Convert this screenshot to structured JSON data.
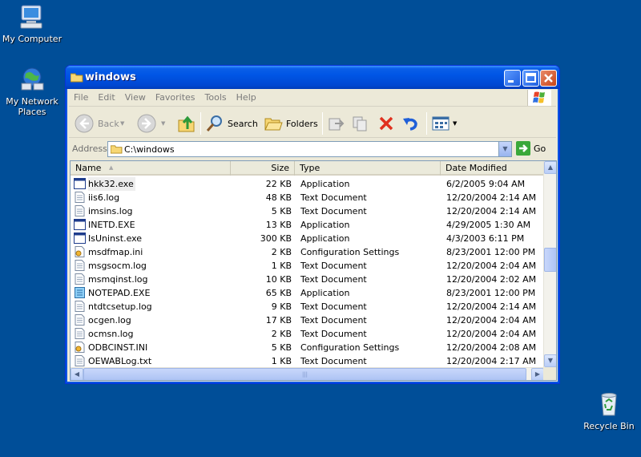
{
  "desktop": {
    "icons": [
      {
        "label": "My Computer",
        "icon": "my-computer-icon"
      },
      {
        "label": "My Network Places",
        "icon": "network-places-icon"
      },
      {
        "label": "Recycle Bin",
        "icon": "recycle-bin-icon"
      }
    ],
    "background_color": "#004e98"
  },
  "window": {
    "title": "windows",
    "menu": [
      "File",
      "Edit",
      "View",
      "Favorites",
      "Tools",
      "Help"
    ],
    "toolbar": {
      "back_label": "Back",
      "search_label": "Search",
      "folders_label": "Folders"
    },
    "address": {
      "label": "Address",
      "value": "C:\\windows",
      "go_label": "Go"
    },
    "columns": {
      "name": "Name",
      "size": "Size",
      "type": "Type",
      "modified": "Date Modified"
    },
    "files": [
      {
        "name": "hkk32.exe",
        "size": "22 KB",
        "type": "Application",
        "modified": "6/2/2005 9:04 AM",
        "icon": "application-icon"
      },
      {
        "name": "iis6.log",
        "size": "48 KB",
        "type": "Text Document",
        "modified": "12/20/2004 2:14 AM",
        "icon": "text-document-icon"
      },
      {
        "name": "imsins.log",
        "size": "5 KB",
        "type": "Text Document",
        "modified": "12/20/2004 2:14 AM",
        "icon": "text-document-icon"
      },
      {
        "name": "INETD.EXE",
        "size": "13 KB",
        "type": "Application",
        "modified": "4/29/2005 1:30 AM",
        "icon": "application-icon"
      },
      {
        "name": "IsUninst.exe",
        "size": "300 KB",
        "type": "Application",
        "modified": "4/3/2003 6:11 PM",
        "icon": "application-icon"
      },
      {
        "name": "msdfmap.ini",
        "size": "2 KB",
        "type": "Configuration Settings",
        "modified": "8/23/2001 12:00 PM",
        "icon": "config-settings-icon"
      },
      {
        "name": "msgsocm.log",
        "size": "1 KB",
        "type": "Text Document",
        "modified": "12/20/2004 2:04 AM",
        "icon": "text-document-icon"
      },
      {
        "name": "msmqinst.log",
        "size": "10 KB",
        "type": "Text Document",
        "modified": "12/20/2004 2:02 AM",
        "icon": "text-document-icon"
      },
      {
        "name": "NOTEPAD.EXE",
        "size": "65 KB",
        "type": "Application",
        "modified": "8/23/2001 12:00 PM",
        "icon": "notepad-icon"
      },
      {
        "name": "ntdtcsetup.log",
        "size": "9 KB",
        "type": "Text Document",
        "modified": "12/20/2004 2:14 AM",
        "icon": "text-document-icon"
      },
      {
        "name": "ocgen.log",
        "size": "17 KB",
        "type": "Text Document",
        "modified": "12/20/2004 2:04 AM",
        "icon": "text-document-icon"
      },
      {
        "name": "ocmsn.log",
        "size": "2 KB",
        "type": "Text Document",
        "modified": "12/20/2004 2:04 AM",
        "icon": "text-document-icon"
      },
      {
        "name": "ODBCINST.INI",
        "size": "5 KB",
        "type": "Configuration Settings",
        "modified": "12/20/2004 2:08 AM",
        "icon": "config-settings-icon"
      },
      {
        "name": "OEWABLog.txt",
        "size": "1 KB",
        "type": "Text Document",
        "modified": "12/20/2004 2:17 AM",
        "icon": "text-document-icon"
      }
    ]
  }
}
